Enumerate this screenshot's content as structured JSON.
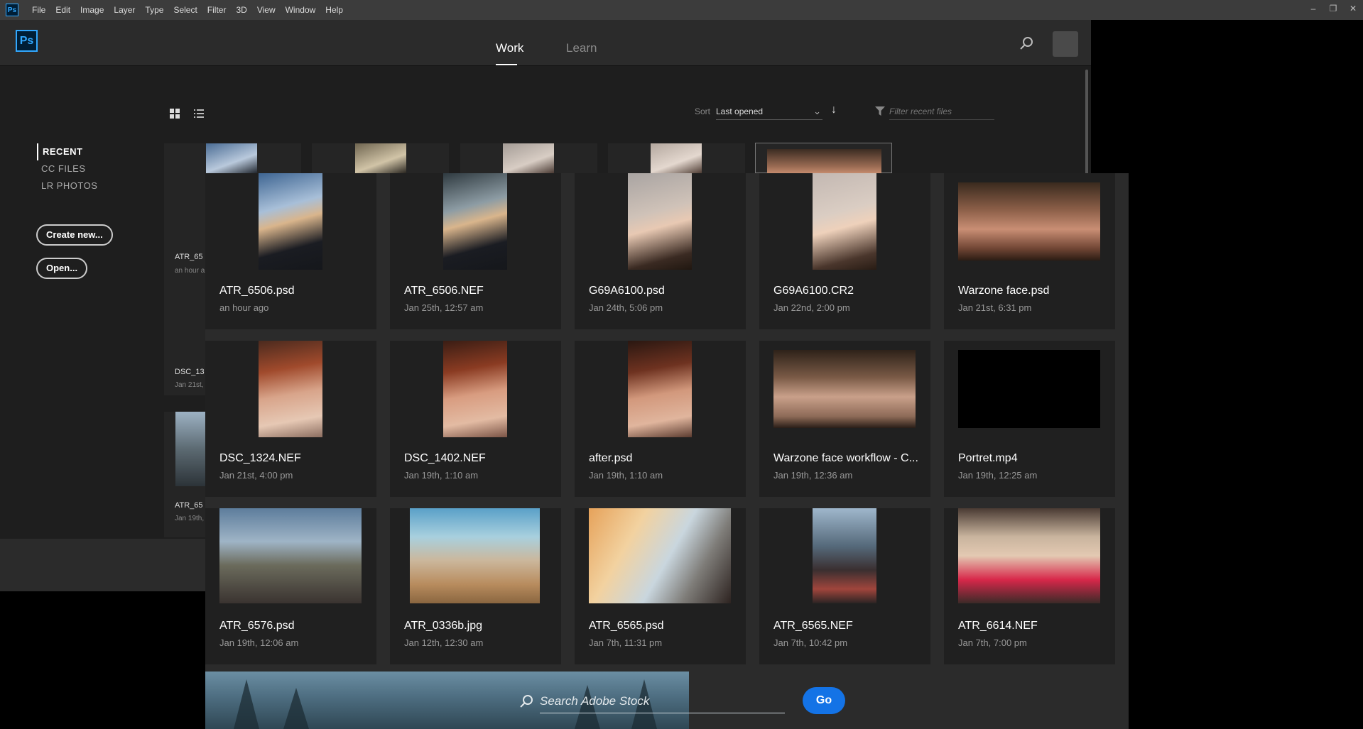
{
  "app": {
    "icon_text": "Ps"
  },
  "menubar": {
    "items": [
      "File",
      "Edit",
      "Image",
      "Layer",
      "Type",
      "Select",
      "Filter",
      "3D",
      "View",
      "Window",
      "Help"
    ],
    "controls": {
      "minimize": "–",
      "restore": "❐",
      "close": "✕"
    }
  },
  "header": {
    "tabs": {
      "work": "Work",
      "learn": "Learn"
    }
  },
  "toolbar": {
    "sort_label": "Sort",
    "sort_value": "Last opened",
    "sort_direction_icon": "↓",
    "filter_placeholder": "Filter recent files"
  },
  "sidebar": {
    "items": [
      "RECENT",
      "CC FILES",
      "LR PHOTOS"
    ],
    "create_new": "Create new...",
    "open": "Open..."
  },
  "background_cards": [
    {
      "title": "ATR_65",
      "date": "an hour a"
    },
    {
      "title": "DSC_13",
      "date": "Jan 21st,"
    },
    {
      "title": "ATR_65",
      "date": "Jan 19th,"
    }
  ],
  "files": [
    {
      "name": "ATR_6506.psd",
      "date": "an hour ago"
    },
    {
      "name": "ATR_6506.NEF",
      "date": "Jan 25th, 12:57 am"
    },
    {
      "name": "G69A6100.psd",
      "date": "Jan 24th, 5:06 pm"
    },
    {
      "name": "G69A6100.CR2",
      "date": "Jan 22nd, 2:00 pm"
    },
    {
      "name": "Warzone face.psd",
      "date": "Jan 21st, 6:31 pm"
    },
    {
      "name": "DSC_1324.NEF",
      "date": "Jan 21st, 4:00 pm"
    },
    {
      "name": "DSC_1402.NEF",
      "date": "Jan 19th, 1:10 am"
    },
    {
      "name": "after.psd",
      "date": "Jan 19th, 1:10 am"
    },
    {
      "name": "Warzone face workflow - C...",
      "date": "Jan 19th, 12:36 am"
    },
    {
      "name": "Portret.mp4",
      "date": "Jan 19th, 12:25 am"
    },
    {
      "name": "ATR_6576.psd",
      "date": "Jan 19th, 12:06 am"
    },
    {
      "name": "ATR_0336b.jpg",
      "date": "Jan 12th, 12:30 am"
    },
    {
      "name": "ATR_6565.psd",
      "date": "Jan 7th, 11:31 pm"
    },
    {
      "name": "ATR_6565.NEF",
      "date": "Jan 7th, 10:42 pm"
    },
    {
      "name": "ATR_6614.NEF",
      "date": "Jan 7th, 7:00 pm"
    }
  ],
  "stock": {
    "placeholder": "Search Adobe Stock",
    "go": "Go"
  },
  "colors": {
    "accent": "#31a8ff",
    "go_button": "#1473e6",
    "panel_bg": "#2b2b2b",
    "card_bg": "#202020"
  }
}
